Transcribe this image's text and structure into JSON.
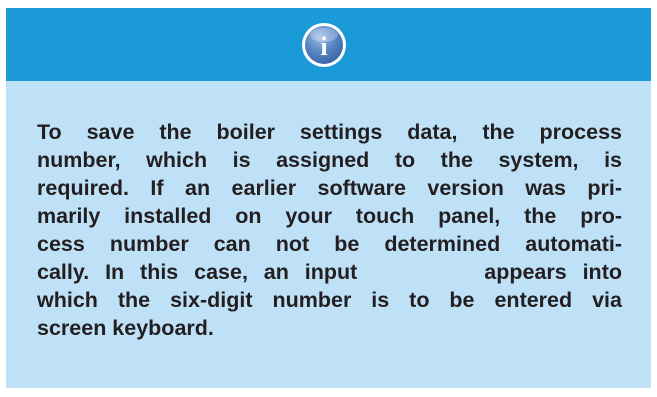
{
  "info_box": {
    "icon": "info-icon",
    "icon_glyph": "i",
    "colors": {
      "header": "#1a9ad6",
      "body": "#bfe1f7",
      "text": "#231f20",
      "icon_fill": "#5a86c4"
    },
    "text_lines": [
      "To save the boiler settings data, the process",
      "number, which is assigned to the system, is",
      "required. If an earlier software version was pri-",
      "marily installed on your touch panel, the pro-",
      "cess number can not be determined automati-",
      "cally. In this case, an input        appears into",
      "which the six-digit number is to be entered via",
      "screen keyboard."
    ]
  }
}
